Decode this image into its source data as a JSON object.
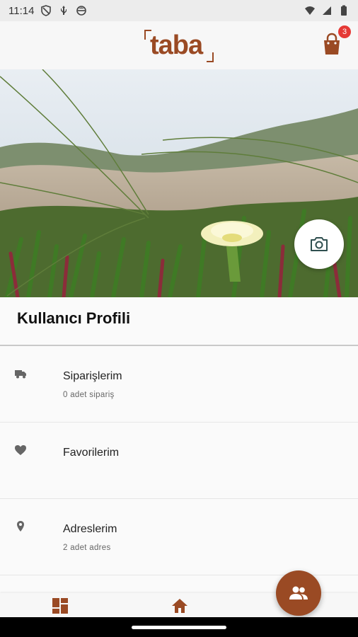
{
  "status_bar": {
    "time": "11:14",
    "icons": [
      "shield-icon",
      "usb-icon",
      "sync-icon",
      "wifi-icon",
      "signal-icon",
      "battery-icon"
    ]
  },
  "header": {
    "logo_text": "taba",
    "cart_count": "3",
    "brand_color": "#9a4a24"
  },
  "profile": {
    "title": "Kullanıcı Profili"
  },
  "menu": [
    {
      "icon": "truck-icon",
      "label": "Siparişlerim",
      "sub": "0 adet sipariş"
    },
    {
      "icon": "heart-icon",
      "label": "Favorilerim",
      "sub": ""
    },
    {
      "icon": "location-pin-icon",
      "label": "Adreslerim",
      "sub": "2 adet adres"
    }
  ],
  "bottom_nav": {
    "items": [
      "dashboard-icon",
      "home-icon"
    ],
    "fab_icon": "people-icon"
  }
}
